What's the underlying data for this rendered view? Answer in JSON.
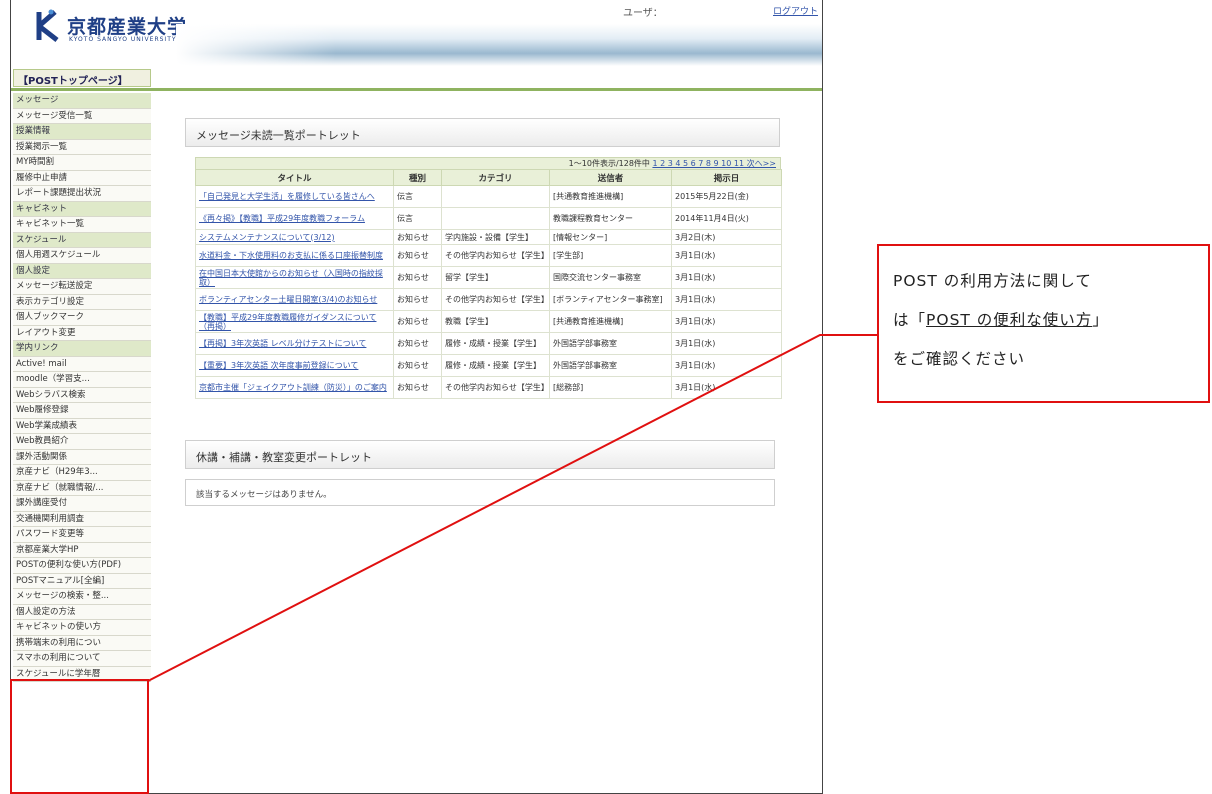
{
  "header": {
    "logo_text": "京都産業大学",
    "logo_subtext": "KYOTO SANGYO UNIVERSITY",
    "user_label": "ユーザ：",
    "logout_label": "ログアウト"
  },
  "top_tab": "【POSTトップページ】",
  "sidebar": {
    "items": [
      {
        "label": "メッセージ",
        "category": true
      },
      {
        "label": "メッセージ受信一覧",
        "category": false
      },
      {
        "label": "授業情報",
        "category": true
      },
      {
        "label": "授業掲示一覧",
        "category": false
      },
      {
        "label": "MY時間割",
        "category": false
      },
      {
        "label": "履修中止申請",
        "category": false
      },
      {
        "label": "レポート課題提出状況",
        "category": false
      },
      {
        "label": "キャビネット",
        "category": true
      },
      {
        "label": "キャビネット一覧",
        "category": false
      },
      {
        "label": "スケジュール",
        "category": true
      },
      {
        "label": "個人用週スケジュール",
        "category": false
      },
      {
        "label": "個人設定",
        "category": true
      },
      {
        "label": "メッセージ転送設定",
        "category": false
      },
      {
        "label": "表示カテゴリ設定",
        "category": false
      },
      {
        "label": "個人ブックマーク",
        "category": false
      },
      {
        "label": "レイアウト変更",
        "category": false
      },
      {
        "label": "学内リンク",
        "category": true
      },
      {
        "label": "Active! mail",
        "category": false
      },
      {
        "label": "moodle（学習支...",
        "category": false
      },
      {
        "label": "Webシラバス検索",
        "category": false
      },
      {
        "label": "Web履修登録",
        "category": false
      },
      {
        "label": "Web学業成績表",
        "category": false
      },
      {
        "label": "Web教員紹介",
        "category": false
      },
      {
        "label": "課外活動関係",
        "category": false
      },
      {
        "label": "京産ナビ（H29年3...",
        "category": false
      },
      {
        "label": "京産ナビ（就職情報/...",
        "category": false
      },
      {
        "label": "課外講座受付",
        "category": false
      },
      {
        "label": "交通機関利用調査",
        "category": false
      },
      {
        "label": "パスワード変更等",
        "category": false
      },
      {
        "label": "京都産業大学HP",
        "category": false
      },
      {
        "label": "POSTの便利な使い方(PDF)",
        "category": false
      },
      {
        "label": "POSTマニュアル[全編]",
        "category": false
      },
      {
        "label": "メッセージの検索・整...",
        "category": false
      },
      {
        "label": "個人設定の方法",
        "category": false
      },
      {
        "label": "キャビネットの使い方",
        "category": false
      },
      {
        "label": "携帯端末の利用につい",
        "category": false
      },
      {
        "label": "スマホの利用について",
        "category": false
      },
      {
        "label": "スケジュールに学年暦",
        "category": false
      }
    ]
  },
  "portlet_messages": {
    "heading": "メッセージ未読一覧ポートレット",
    "pager_text": "1～10件表示/128件中",
    "pager_pages": "1 2 3 4 5 6 7 8 9 10 11 次へ>>",
    "columns": [
      "タイトル",
      "種別",
      "カテゴリ",
      "送信者",
      "掲示日"
    ],
    "rows": [
      {
        "title": "「自己発見と大学生活」を履修している皆さんへ",
        "type": "伝言",
        "category": "",
        "sender": "[共通教育推進機構]",
        "date": "2015年5月22日(金)"
      },
      {
        "title": "《再々掲》【教職】平成29年度教職フォーラム",
        "type": "伝言",
        "category": "",
        "sender": "教職課程教育センター",
        "date": "2014年11月4日(火)"
      },
      {
        "title": "システムメンテナンスについて(3/12)",
        "type": "お知らせ",
        "category": "学内施設・設備【学生】",
        "sender": "[情報センター]",
        "date": "3月2日(木)"
      },
      {
        "title": "水道料金・下水使用料のお支払に係る口座振替制度",
        "type": "お知らせ",
        "category": "その他学内お知らせ【学生】",
        "sender": "[学生部]",
        "date": "3月1日(水)"
      },
      {
        "title": "在中国日本大使館からのお知らせ（入国時の指紋採取）",
        "type": "お知らせ",
        "category": "留学【学生】",
        "sender": "国際交流センター事務室",
        "date": "3月1日(水)"
      },
      {
        "title": "ボランティアセンター土曜日開室(3/4)のお知らせ",
        "type": "お知らせ",
        "category": "その他学内お知らせ【学生】",
        "sender": "[ボランティアセンター事務室]",
        "date": "3月1日(水)"
      },
      {
        "title": "【教職】平成29年度教職履修ガイダンスについて（再掲）",
        "type": "お知らせ",
        "category": "教職【学生】",
        "sender": "[共通教育推進機構]",
        "date": "3月1日(水)"
      },
      {
        "title": "【再掲】3年次英語 レベル分けテストについて",
        "type": "お知らせ",
        "category": "履修・成績・授業【学生】",
        "sender": "外国語学部事務室",
        "date": "3月1日(水)"
      },
      {
        "title": "【重要】3年次英語 次年度事前登録について",
        "type": "お知らせ",
        "category": "履修・成績・授業【学生】",
        "sender": "外国語学部事務室",
        "date": "3月1日(水)"
      },
      {
        "title": "京都市主催「ジェイクアウト訓練（防災）」のご案内",
        "type": "お知らせ",
        "category": "その他学内お知らせ【学生】",
        "sender": "[総務部]",
        "date": "3月1日(水)"
      }
    ]
  },
  "portlet_classes": {
    "heading": "休講・補講・教室変更ポートレット",
    "empty_text": "該当するメッセージはありません。"
  },
  "callout": {
    "line1": "POST の利用方法に関して",
    "line2_prefix": "は「",
    "line2_link": "POST の便利な使い方",
    "line2_suffix": "」",
    "line3": "をご確認ください",
    "border_color": "#e01010"
  }
}
